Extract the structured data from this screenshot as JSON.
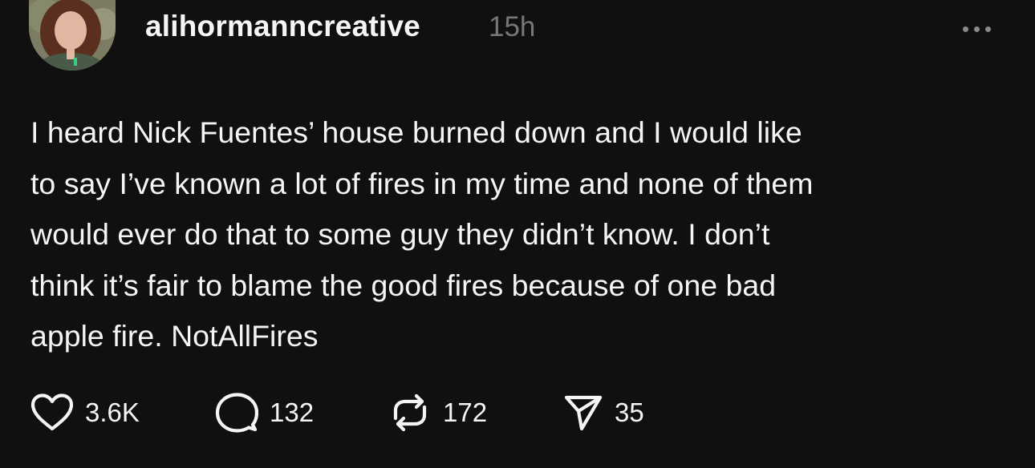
{
  "post": {
    "username": "alihormanncreative",
    "timestamp": "15h",
    "text": "I heard Nick Fuentes’ house burned down and I would like\nto say I’ve known a lot of fires in my time and none of them\nwould ever do that to some guy they didn’t know. I don’t\nthink it’s fair to blame the good fires because of one bad\napple fire. NotAllFires",
    "avatar_icon": "profile-photo",
    "more_icon": "ellipsis-icon"
  },
  "actions": {
    "like": {
      "icon": "heart-icon",
      "count": "3.6K"
    },
    "reply": {
      "icon": "comment-icon",
      "count": "132"
    },
    "repost": {
      "icon": "repost-icon",
      "count": "172"
    },
    "share": {
      "icon": "send-icon",
      "count": "35"
    }
  },
  "colors": {
    "background": "#101010",
    "text": "#f3f5f7",
    "muted": "#777777"
  }
}
